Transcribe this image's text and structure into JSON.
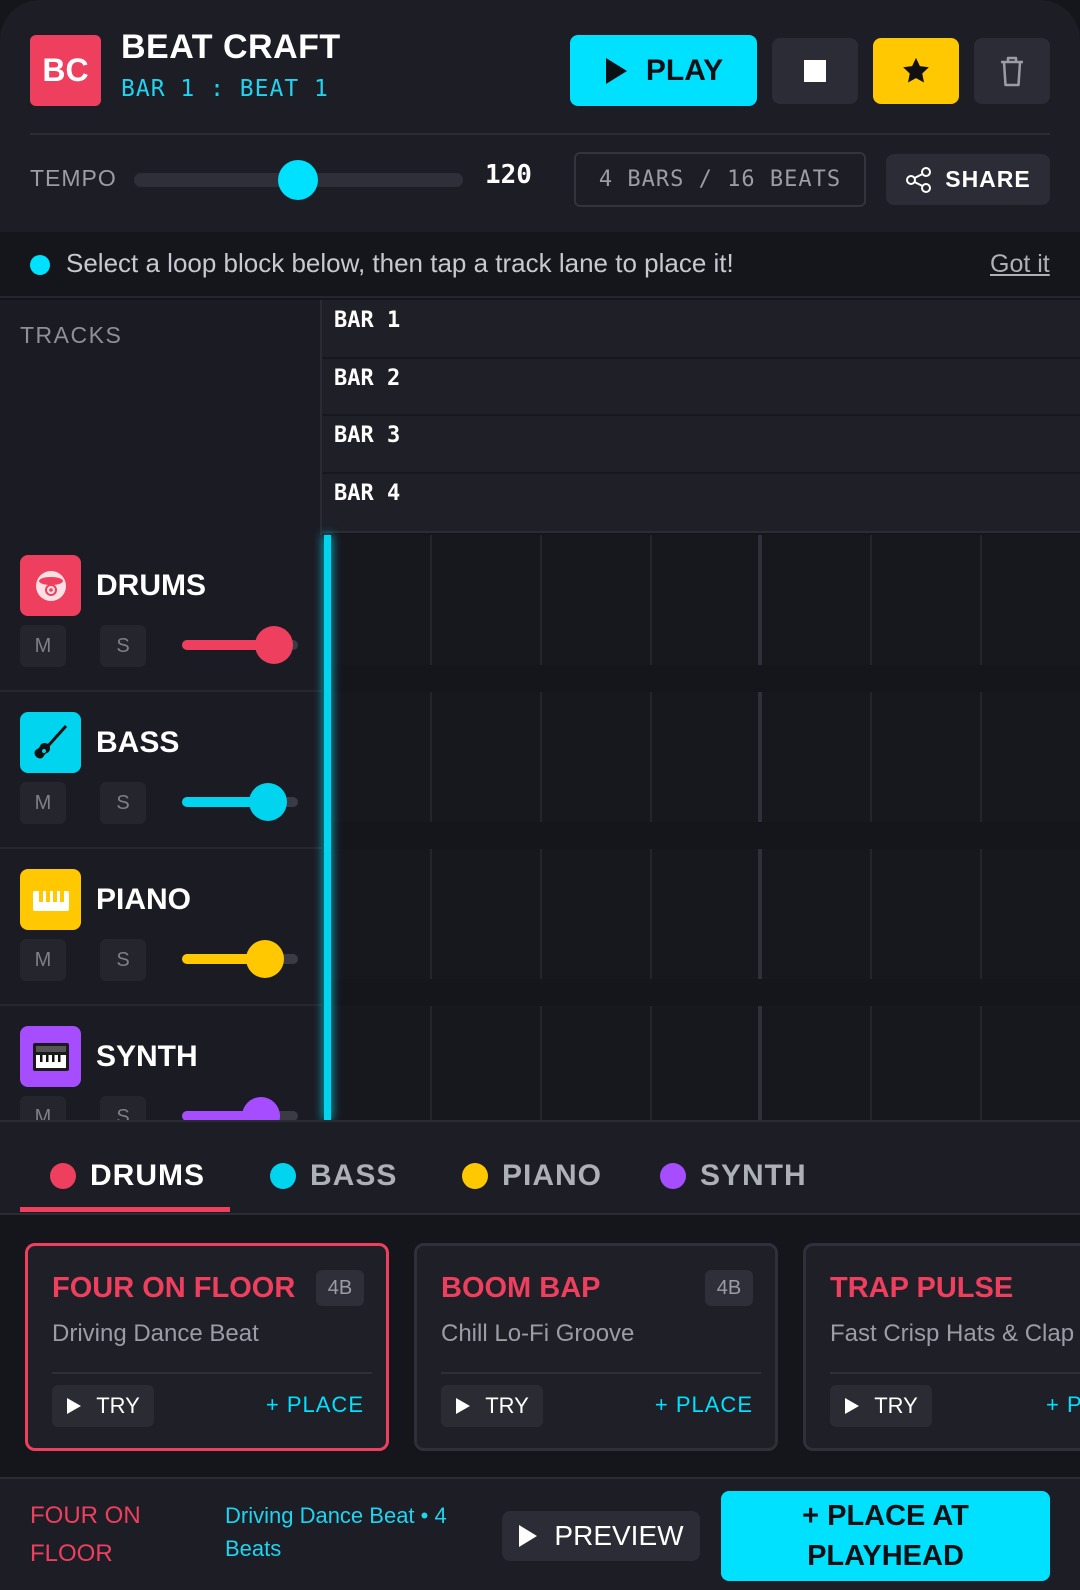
{
  "header": {
    "logo": "BC",
    "title": "BEAT CRAFT",
    "position": "BAR 1 : BEAT 1",
    "play_label": "PLAY",
    "tempo_label": "TEMPO",
    "tempo_value": "120",
    "tempo_level": 0.5,
    "bars_info": "4 BARS / 16 BEATS",
    "share_label": "SHARE"
  },
  "hint": {
    "text": "Select a loop block below, then tap a track lane to place it!",
    "dismiss": "Got it"
  },
  "timeline": {
    "tracks_label": "TRACKS",
    "bars": [
      "BAR 1",
      "BAR 2",
      "BAR 3",
      "BAR 4"
    ]
  },
  "tracks": [
    {
      "name": "DRUMS",
      "mute": "M",
      "solo": "S",
      "color": "#ef3f5e",
      "icon": "drum-icon",
      "volume": 0.8
    },
    {
      "name": "BASS",
      "mute": "M",
      "solo": "S",
      "color": "#00d4ef",
      "icon": "guitar-icon",
      "volume": 0.75
    },
    {
      "name": "PIANO",
      "mute": "M",
      "solo": "S",
      "color": "#ffc800",
      "icon": "piano-icon",
      "volume": 0.72
    },
    {
      "name": "SYNTH",
      "mute": "M",
      "solo": "S",
      "color": "#a64dff",
      "icon": "keyboard-icon",
      "volume": 0.68
    }
  ],
  "categories": [
    {
      "label": "DRUMS",
      "color": "#ef3f5e",
      "active": true
    },
    {
      "label": "BASS",
      "color": "#00d4ef",
      "active": false
    },
    {
      "label": "PIANO",
      "color": "#ffc800",
      "active": false
    },
    {
      "label": "SYNTH",
      "color": "#a64dff",
      "active": false
    }
  ],
  "loops": [
    {
      "title": "FOUR ON FLOOR",
      "badge": "4B",
      "subtitle": "Driving Dance Beat",
      "try": "TRY",
      "place": "+ PLACE",
      "selected": true
    },
    {
      "title": "BOOM BAP",
      "badge": "4B",
      "subtitle": "Chill Lo-Fi Groove",
      "try": "TRY",
      "place": "+ PLACE",
      "selected": false
    },
    {
      "title": "TRAP PULSE",
      "badge": "",
      "subtitle": "Fast Crisp Hats & Clap",
      "try": "TRY",
      "place": "+ P",
      "selected": false
    }
  ],
  "footer": {
    "selected_name": "FOUR ON FLOOR",
    "selected_desc": "Driving Dance Beat • 4 Beats",
    "preview_label": "PREVIEW",
    "place_label": "+ PLACE AT PLAYHEAD"
  }
}
